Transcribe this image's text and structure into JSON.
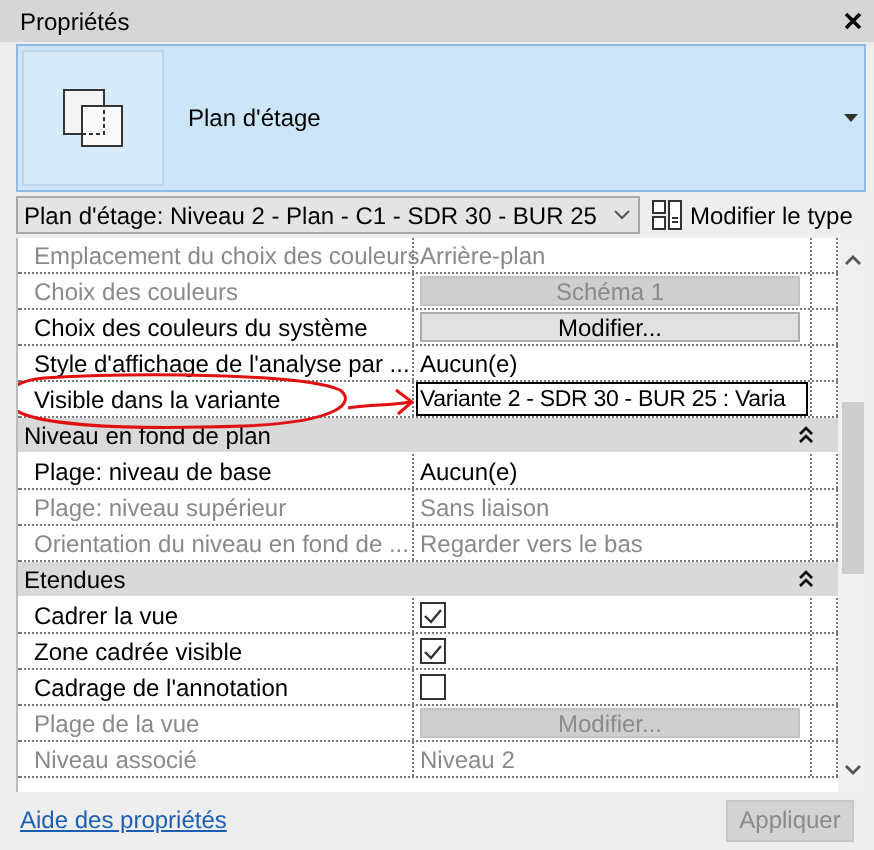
{
  "panel": {
    "title": "Propriétés"
  },
  "type_selector": {
    "label": "Plan d'étage"
  },
  "instance_dropdown": {
    "value": "Plan d'étage: Niveau 2 - Plan - C1 - SDR 30 - BUR 25"
  },
  "edit_type_button": {
    "label": "Modifier le type"
  },
  "rows": [
    {
      "kind": "text",
      "label": "Emplacement du choix des couleurs",
      "value": "Arrière-plan",
      "disabled": true
    },
    {
      "kind": "button",
      "label": "Choix des couleurs",
      "value": "Schéma 1",
      "disabled": true
    },
    {
      "kind": "button",
      "label": "Choix des couleurs du système",
      "value": "Modifier...",
      "disabled": false
    },
    {
      "kind": "text",
      "label": "Style d'affichage de l'analyse par ...",
      "value": "Aucun(e)",
      "disabled": false
    },
    {
      "kind": "field",
      "label": "Visible dans la variante",
      "value": "Variante 2 - SDR 30 - BUR 25 : Varia",
      "highlighted": true
    },
    {
      "kind": "group",
      "label": "Niveau en fond de plan",
      "expanded": true
    },
    {
      "kind": "text",
      "label": "Plage: niveau de base",
      "value": "Aucun(e)",
      "disabled": false
    },
    {
      "kind": "text",
      "label": "Plage: niveau supérieur",
      "value": "Sans liaison",
      "disabled": true
    },
    {
      "kind": "text",
      "label": "Orientation du niveau en fond de ...",
      "value": "Regarder vers le bas",
      "disabled": true
    },
    {
      "kind": "group",
      "label": "Etendues",
      "expanded": true
    },
    {
      "kind": "checkbox",
      "label": "Cadrer la vue",
      "checked": true
    },
    {
      "kind": "checkbox",
      "label": "Zone cadrée visible",
      "checked": true
    },
    {
      "kind": "checkbox",
      "label": "Cadrage de l'annotation",
      "checked": false
    },
    {
      "kind": "button",
      "label": "Plage de la vue",
      "value": "Modifier...",
      "disabled": true
    },
    {
      "kind": "text",
      "label": "Niveau associé",
      "value": "Niveau 2",
      "disabled": true
    }
  ],
  "footer": {
    "help_link": "Aide des propriétés",
    "apply_button": {
      "label": "Appliquer",
      "disabled": true
    }
  }
}
